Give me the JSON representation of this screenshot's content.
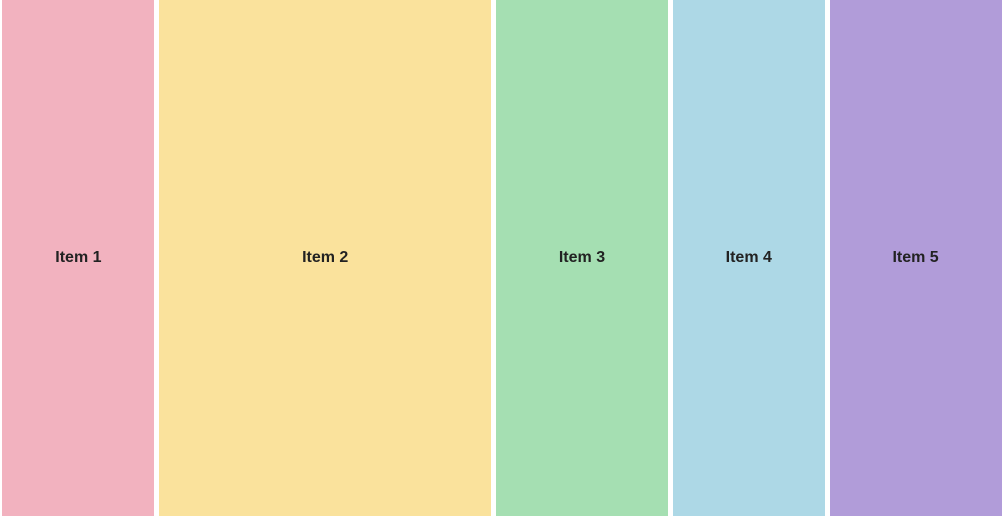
{
  "items": [
    {
      "label": "Item 1",
      "color": "#f2b2bf"
    },
    {
      "label": "Item 2",
      "color": "#fae29c"
    },
    {
      "label": "Item 3",
      "color": "#a5dfb2"
    },
    {
      "label": "Item 4",
      "color": "#add8e6"
    },
    {
      "label": "Item 5",
      "color": "#b19cd9"
    }
  ]
}
